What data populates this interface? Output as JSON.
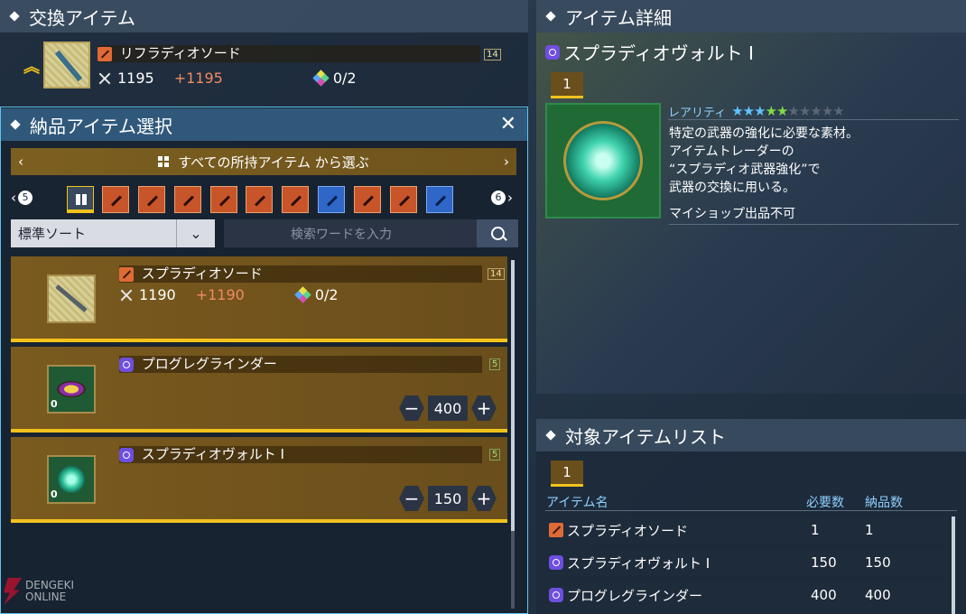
{
  "exchange": {
    "header": "交換アイテム",
    "item_name": "リフラディオソード",
    "level_badge": "14",
    "attack": "1195",
    "bonus": "+1195",
    "slots": "0/2"
  },
  "select": {
    "header": "納品アイテム選択",
    "close": "✕",
    "source_label": "すべての所持アイテム から選ぶ",
    "page_left": "5",
    "page_right": "6",
    "sort_label": "標準ソート",
    "search_placeholder": "検索ワードを入力",
    "tabs": [
      "all",
      "weapon",
      "weapon",
      "weapon",
      "weapon",
      "weapon",
      "weapon",
      "weapon-blue",
      "weapon",
      "weapon",
      "weapon-blue"
    ],
    "items": [
      {
        "name": "スプラディオソード",
        "badge": "14",
        "attack": "1190",
        "bonus": "+1190",
        "slots": "0/2"
      },
      {
        "name": "プログレグラインダー",
        "badge": "5",
        "count": "0",
        "qty": "400"
      },
      {
        "name": "スプラディオヴォルト I",
        "badge": "5",
        "count": "0",
        "qty": "150"
      }
    ]
  },
  "detail": {
    "header": "アイテム詳細",
    "title": "スプラディオヴォルト I",
    "tab": "1",
    "rarity_label": "レアリティ",
    "rarity": 5,
    "rarity_max": 10,
    "desc": [
      "特定の武器の強化に必要な素材。",
      "アイテムトレーダーの",
      "“スプラディオ武器強化”で",
      "武器の交換に用いる。"
    ],
    "note": "マイショップ出品不可"
  },
  "targets": {
    "header": "対象アイテムリスト",
    "tab": "1",
    "col_name": "アイテム名",
    "col_req": "必要数",
    "col_del": "納品数",
    "rows": [
      {
        "name": "スプラディオソード",
        "type": "weapon",
        "req": "1",
        "del": "1"
      },
      {
        "name": "スプラディオヴォルト I",
        "type": "material",
        "req": "150",
        "del": "150"
      },
      {
        "name": "プログレグラインダー",
        "type": "material",
        "req": "400",
        "del": "400"
      }
    ]
  },
  "watermark": {
    "line1": "DENGEKI",
    "line2": "ONLINE"
  },
  "colors": {
    "gold": "#f2c21b",
    "card": "#7a5a1e",
    "star_on": "#5fc3ff",
    "star_green": "#7fdc4a",
    "weapon_icon": "#e06a36",
    "material_icon": "#6e4fe0"
  }
}
